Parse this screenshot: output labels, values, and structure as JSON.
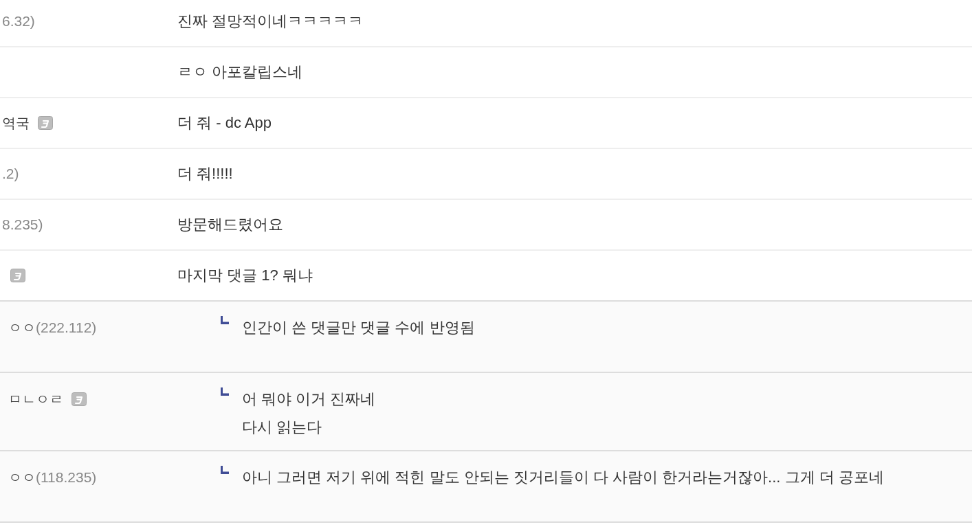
{
  "comments": [
    {
      "kind": "comment",
      "ip": "6.32)",
      "badge": false,
      "text": "진짜 절망적이네ㅋㅋㅋㅋㅋ"
    },
    {
      "kind": "comment",
      "badge": false,
      "text": "ㄹㅇ 아포칼립스네"
    },
    {
      "kind": "comment",
      "nickname": "역국",
      "badge": true,
      "text": "더 줘 - dc App"
    },
    {
      "kind": "comment",
      "ip": ".2)",
      "badge": false,
      "text": "더 줘!!!!!"
    },
    {
      "kind": "comment",
      "ip": "8.235)",
      "badge": false,
      "text": "방문해드렸어요"
    },
    {
      "kind": "comment",
      "badge": true,
      "text": "마지막 댓글 1? 뭐냐"
    },
    {
      "kind": "reply",
      "nickname": "ㅇㅇ",
      "ip": "(222.112)",
      "badge": false,
      "text": "인간이 쓴 댓글만 댓글 수에 반영됨"
    },
    {
      "kind": "reply",
      "nickname": "ㅁㄴㅇㄹ",
      "badge": true,
      "text": "어 뭐야 이거 진짜네\n다시 읽는다"
    },
    {
      "kind": "reply",
      "nickname": "ㅇㅇ",
      "ip": "(118.235)",
      "badge": false,
      "text": "아니 그러면 저기 위에 적힌 말도 안되는 짓거리들이 다 사람이 한거라는거잖아... 그게 더 공포네"
    }
  ]
}
